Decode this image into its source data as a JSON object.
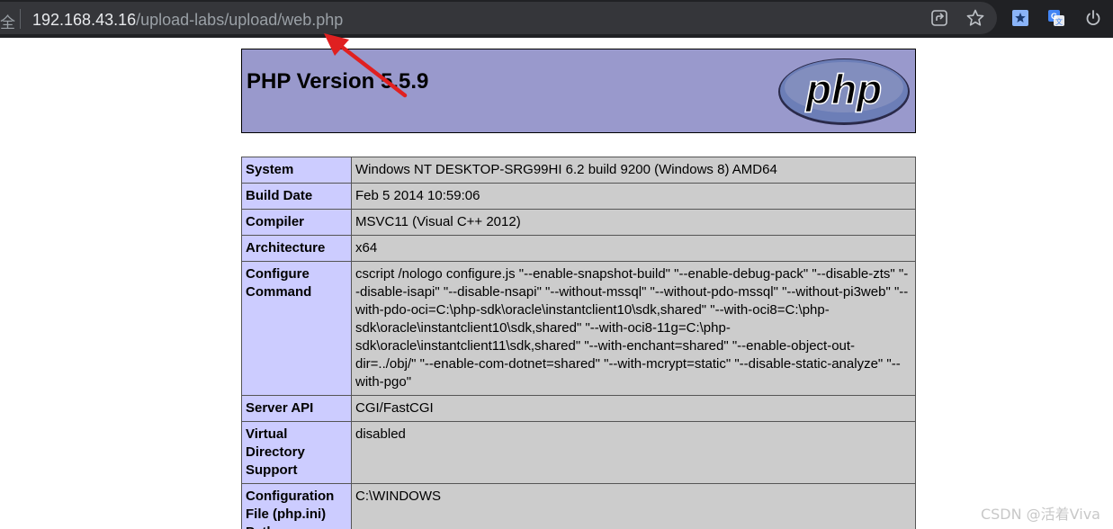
{
  "browser": {
    "security_label": "全",
    "url_host": "192.168.43.16",
    "url_path": "/upload-labs/upload/web.php",
    "icons": [
      "share-icon",
      "bookmark-star-icon",
      "extension-star-icon",
      "translate-icon",
      "power-icon"
    ]
  },
  "php": {
    "title": "PHP Version 5.5.9",
    "logo_text": "php"
  },
  "info_rows": [
    {
      "key": "System",
      "value": "Windows NT DESKTOP-SRG99HI 6.2 build 9200 (Windows 8) AMD64"
    },
    {
      "key": "Build Date",
      "value": "Feb 5 2014 10:59:06"
    },
    {
      "key": "Compiler",
      "value": "MSVC11 (Visual C++ 2012)"
    },
    {
      "key": "Architecture",
      "value": "x64"
    },
    {
      "key": "Configure Command",
      "value": "cscript /nologo configure.js \"--enable-snapshot-build\" \"--enable-debug-pack\" \"--disable-zts\" \"--disable-isapi\" \"--disable-nsapi\" \"--without-mssql\" \"--without-pdo-mssql\" \"--without-pi3web\" \"--with-pdo-oci=C:\\php-sdk\\oracle\\instantclient10\\sdk,shared\" \"--with-oci8=C:\\php-sdk\\oracle\\instantclient10\\sdk,shared\" \"--with-oci8-11g=C:\\php-sdk\\oracle\\instantclient11\\sdk,shared\" \"--with-enchant=shared\" \"--enable-object-out-dir=../obj/\" \"--enable-com-dotnet=shared\" \"--with-mcrypt=static\" \"--disable-static-analyze\" \"--with-pgo\""
    },
    {
      "key": "Server API",
      "value": "CGI/FastCGI"
    },
    {
      "key": "Virtual Directory Support",
      "value": "disabled"
    },
    {
      "key": "Configuration File (php.ini) Path",
      "value": "C:\\WINDOWS"
    }
  ],
  "watermark": "CSDN @活着Viva"
}
